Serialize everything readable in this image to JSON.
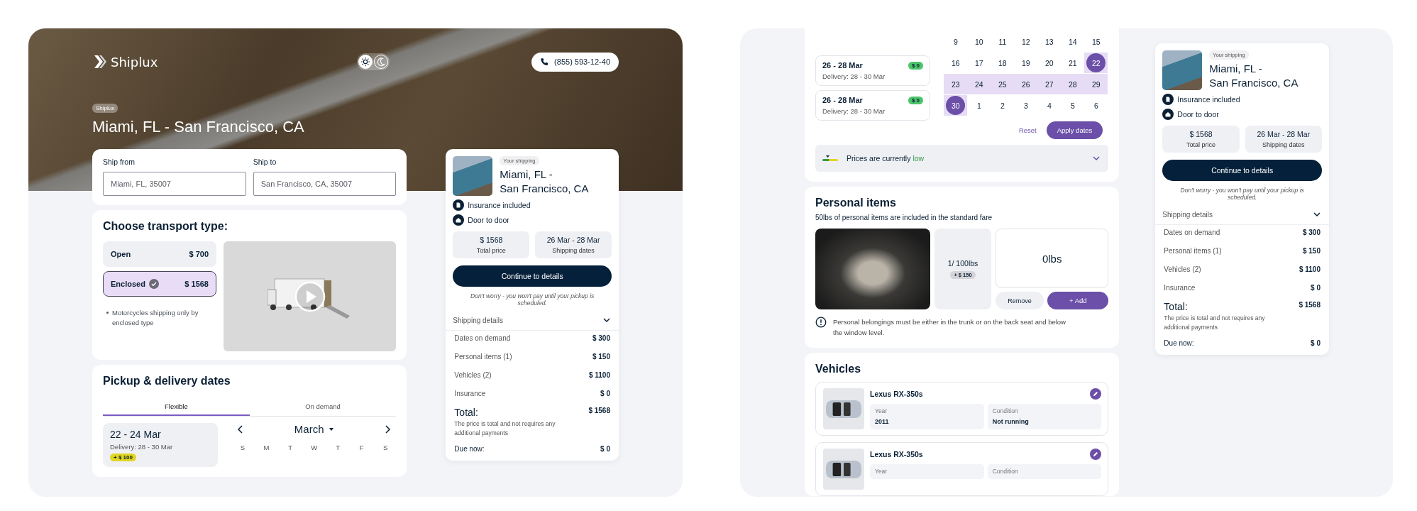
{
  "left_screen": {
    "header": {
      "logo": "Shiplux",
      "theme_toggle": [
        {
          "kind": "light",
          "selected": true
        },
        {
          "kind": "dark",
          "selected": false
        }
      ],
      "phone": "(855) 593-12-40"
    },
    "hero": {
      "tag": "Shiplux",
      "title": "Miami, FL - San Francisco, CA"
    },
    "route_form": {
      "fields": [
        {
          "label": "Ship from",
          "placeholder": "Miami, FL, 35007"
        },
        {
          "label": "Ship to",
          "placeholder": "San Francisco, CA, 35007"
        }
      ]
    },
    "transport": {
      "title": "Choose transport type:",
      "options": [
        {
          "name": "Open",
          "price": "$ 700",
          "selected": false
        },
        {
          "name": "Enclosed",
          "price": "$ 1568",
          "selected": true
        }
      ],
      "note": "Motorcycles shipping only by enclosed type"
    },
    "dates": {
      "title": "Pickup & delivery dates",
      "tabs": [
        {
          "label": "Flexible",
          "selected": true
        },
        {
          "label": "On demand",
          "selected": false
        }
      ],
      "options": [
        {
          "dates": "22 - 24 Mar",
          "delivery": "Delivery: 28 - 30 Mar",
          "price": "+ $ 100",
          "color": "#e2d622",
          "selected": true
        }
      ],
      "calendar": {
        "month": "March",
        "weekdays": [
          "S",
          "M",
          "T",
          "W",
          "T",
          "F",
          "S"
        ]
      }
    },
    "summary": {
      "tag": "Your shipping",
      "title": "Miami, FL -\nSan Francisco, CA",
      "features": [
        {
          "kind": "insurance",
          "text": "Insurance included"
        },
        {
          "kind": "home",
          "text": "Door to door"
        }
      ],
      "stats": [
        {
          "value": "$ 1568",
          "label": "Total price"
        },
        {
          "value": "26 Mar - 28 Mar",
          "label": "Shipping dates"
        }
      ],
      "button": "Continue to details",
      "note": "Don't worry - you won't pay until your pickup is scheduled.",
      "details_title": "Shipping details",
      "lines": [
        {
          "label": "Dates on demand",
          "value": "$ 300"
        },
        {
          "label": "Personal items (1)",
          "value": "$ 150"
        },
        {
          "label": "Vehicles (2)",
          "value": "$ 1100"
        },
        {
          "label": "Insurance",
          "value": "$ 0"
        }
      ],
      "total_label": "Total:",
      "total_value": "$ 1568",
      "total_note": "The price is total and not requires any additional payments",
      "due_label": "Due now:",
      "due_value": "$ 0"
    }
  },
  "right_screen": {
    "dates": {
      "options": [
        {
          "dates": "26 - 28 Mar",
          "delivery": "Delivery: 28 - 30 Mar",
          "price": "$ 0",
          "color": "#4cc46a",
          "selected": false
        },
        {
          "dates": "26 - 28 Mar",
          "delivery": "Delivery: 28 - 30 Mar",
          "price": "$ 0",
          "color": "#4cc46a",
          "selected": false
        }
      ],
      "calendar": {
        "weeks": [
          [
            {
              "day": "9",
              "selected": false,
              "in_range": false
            },
            {
              "day": "10",
              "selected": false,
              "in_range": false
            },
            {
              "day": "11",
              "selected": false,
              "in_range": false
            },
            {
              "day": "12",
              "selected": false,
              "in_range": false
            },
            {
              "day": "13",
              "selected": false,
              "in_range": false
            },
            {
              "day": "14",
              "selected": false,
              "in_range": false
            },
            {
              "day": "15",
              "selected": false,
              "in_range": false
            }
          ],
          [
            {
              "day": "16",
              "selected": false,
              "in_range": false
            },
            {
              "day": "17",
              "selected": false,
              "in_range": false
            },
            {
              "day": "18",
              "selected": false,
              "in_range": false
            },
            {
              "day": "19",
              "selected": false,
              "in_range": false
            },
            {
              "day": "20",
              "selected": false,
              "in_range": false
            },
            {
              "day": "21",
              "selected": false,
              "in_range": false
            },
            {
              "day": "22",
              "selected": true,
              "in_range": true
            }
          ],
          [
            {
              "day": "23",
              "selected": false,
              "in_range": true
            },
            {
              "day": "24",
              "selected": false,
              "in_range": true
            },
            {
              "day": "25",
              "selected": false,
              "in_range": true
            },
            {
              "day": "26",
              "selected": false,
              "in_range": true
            },
            {
              "day": "27",
              "selected": false,
              "in_range": true
            },
            {
              "day": "28",
              "selected": false,
              "in_range": true
            },
            {
              "day": "29",
              "selected": false,
              "in_range": true
            }
          ],
          [
            {
              "day": "30",
              "selected": true,
              "in_range": true
            },
            {
              "day": "1",
              "selected": false,
              "in_range": false
            },
            {
              "day": "2",
              "selected": false,
              "in_range": false
            },
            {
              "day": "3",
              "selected": false,
              "in_range": false
            },
            {
              "day": "4",
              "selected": false,
              "in_range": false
            },
            {
              "day": "5",
              "selected": false,
              "in_range": false
            },
            {
              "day": "6",
              "selected": false,
              "in_range": false
            }
          ]
        ]
      },
      "reset": "Reset",
      "apply": "Apply dates",
      "price_level": {
        "text": "Prices are currently",
        "highlight": "low",
        "color": "#3a9a48"
      }
    },
    "personal_items": {
      "title": "Personal items",
      "subtitle": "50lbs of personal items are included in the standard fare",
      "count": "1/ 100lbs",
      "count_price": "+ $ 150",
      "weight": "0lbs",
      "remove": "Remove",
      "add": "+ Add",
      "note": "Personal belongings must be either in the trunk or on the back seat and below the window level."
    },
    "vehicles": {
      "title": "Vehicles",
      "items": [
        {
          "name": "Lexus RX-350s",
          "fields": [
            {
              "label": "Year",
              "value": "2011"
            },
            {
              "label": "Condition",
              "value": "Not running"
            }
          ]
        },
        {
          "name": "Lexus RX-350s",
          "fields": [
            {
              "label": "Year"
            },
            {
              "label": "Condition"
            }
          ]
        }
      ]
    },
    "summary": {
      "tag": "Your shipping",
      "title": "Miami, FL -\nSan Francisco, CA",
      "features": [
        {
          "kind": "insurance",
          "text": "Insurance included"
        },
        {
          "kind": "home",
          "text": "Door to door"
        }
      ],
      "stats": [
        {
          "value": "$ 1568",
          "label": "Total price"
        },
        {
          "value": "26 Mar - 28 Mar",
          "label": "Shipping dates"
        }
      ],
      "button": "Continue to details",
      "note": "Don't worry - you won't pay until your pickup is scheduled.",
      "details_title": "Shipping details",
      "lines": [
        {
          "label": "Dates on demand",
          "value": "$ 300"
        },
        {
          "label": "Personal items (1)",
          "value": "$ 150"
        },
        {
          "label": "Vehicles (2)",
          "value": "$ 1100"
        },
        {
          "label": "Insurance",
          "value": "$ 0"
        }
      ],
      "total_label": "Total:",
      "total_value": "$ 1568",
      "total_note": "The price is total and not requires any additional payments",
      "due_label": "Due now:",
      "due_value": "$ 0"
    }
  }
}
